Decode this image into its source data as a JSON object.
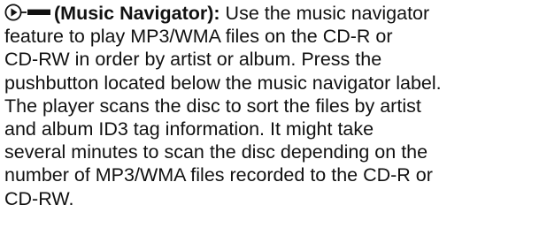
{
  "section": {
    "symbol": "music-navigator-icon",
    "heading": "(Music Navigator):",
    "lead": " Use the music navigator",
    "lines": [
      "feature to play MP3/WMA files on the CD-R or",
      "CD-RW in order by artist or album. Press the",
      "pushbutton located below the music navigator label.",
      "The player scans the disc to sort the files by artist",
      "and album ID3 tag information. It might take",
      "several minutes to scan the disc depending on the",
      "number of MP3/WMA files recorded to the CD-R or",
      "CD-RW."
    ]
  }
}
